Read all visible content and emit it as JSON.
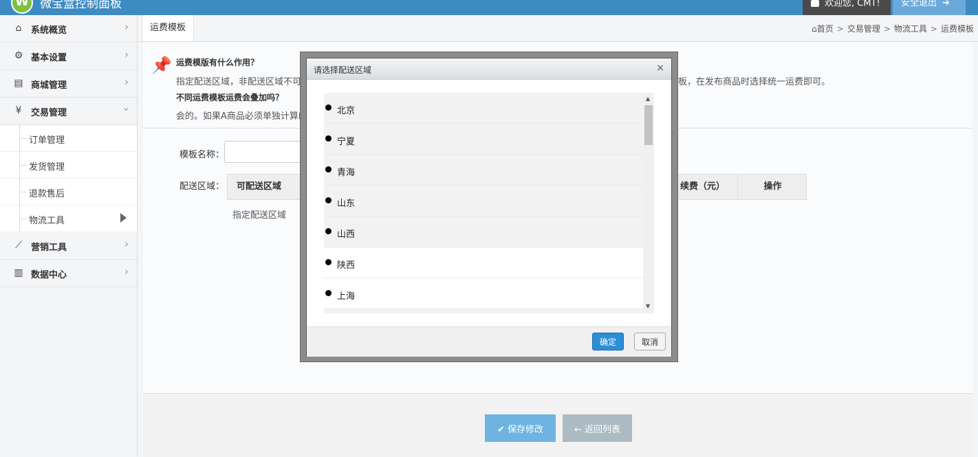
{
  "header": {
    "logo_letter": "W",
    "title": "微宝盒控制面板",
    "welcome": "欢迎您, CMT!",
    "logout": "安全退出"
  },
  "sidebar": {
    "items": [
      {
        "label": "系统概览",
        "icon": "home-icon"
      },
      {
        "label": "基本设置",
        "icon": "gear-icon"
      },
      {
        "label": "商城管理",
        "icon": "shop-icon"
      },
      {
        "label": "交易管理",
        "icon": "yen-icon"
      }
    ],
    "sub_items": [
      {
        "label": "订单管理"
      },
      {
        "label": "发货管理"
      },
      {
        "label": "退款售后"
      },
      {
        "label": "物流工具"
      }
    ],
    "items_after": [
      {
        "label": "营销工具",
        "icon": "chart-line-icon"
      },
      {
        "label": "数据中心",
        "icon": "bar-chart-icon"
      }
    ]
  },
  "tabs": [
    {
      "label": "运费模板"
    }
  ],
  "breadcrumb": [
    "首页",
    "交易管理",
    "物流工具",
    "运费模板"
  ],
  "tips": {
    "q1": "运费模版有什么作用？",
    "a1_start": "指定配送区域，非配送区域不可",
    "a1_end": "模板，在发布商品时选择统一运费即可。",
    "q2": "不同运费模板运费会叠加吗？",
    "a2": "会的。如果A商品必须单独计算邮"
  },
  "form": {
    "name_label": "模板名称：",
    "name_value": "",
    "area_label": "配送区域：",
    "table_headers": [
      "可配送区域",
      "续费（元）",
      "操作"
    ],
    "area_link": "指定配送区域"
  },
  "actions": {
    "save": "保存修改",
    "back": "返回列表"
  },
  "modal": {
    "title": "请选择配送区域",
    "close": "×",
    "regions": [
      "北京",
      "宁夏",
      "青海",
      "山东",
      "山西",
      "陕西",
      "上海"
    ],
    "ok": "确定",
    "cancel": "取消"
  }
}
